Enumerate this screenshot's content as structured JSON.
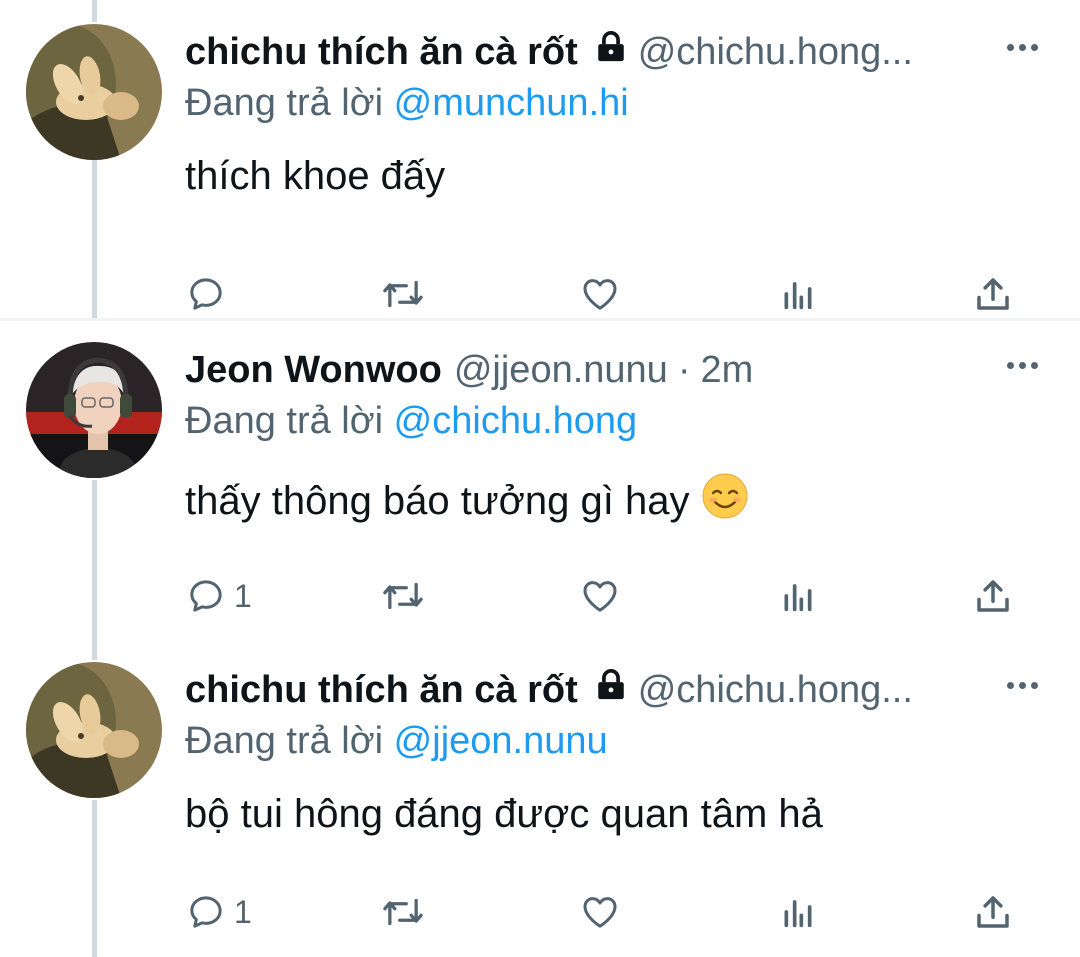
{
  "tweets": [
    {
      "name": "chichu thích ăn cà rốt",
      "handle": "@chichu.hong...",
      "locked": true,
      "time": "",
      "replying_prefix": "Đang trả lời",
      "replying_to": "@munchun.hi",
      "text": "thích khoe đấy",
      "reply_count": "",
      "avatar": "bunny-avatar"
    },
    {
      "name": "Jeon Wonwoo",
      "handle": "@jjeon.nunu",
      "locked": false,
      "separator": "·",
      "time": "2m",
      "replying_prefix": "Đang trả lời",
      "replying_to": "@chichu.hong",
      "text": "thấy thông báo tưởng gì hay",
      "emoji": "smiling-face-emoji",
      "reply_count": "1",
      "avatar": "person-with-headset-avatar"
    },
    {
      "name": "chichu thích ăn cà rốt",
      "handle": "@chichu.hong...",
      "locked": true,
      "time": "",
      "replying_prefix": "Đang trả lời",
      "replying_to": "@jjeon.nunu",
      "text": "bộ tui hông đáng được quan tâm hả",
      "reply_count": "1",
      "avatar": "bunny-avatar"
    }
  ],
  "icons": {
    "reply": "reply-icon",
    "retweet": "retweet-icon",
    "like": "heart-icon",
    "views": "views-icon",
    "share": "share-icon",
    "more": "more-icon",
    "lock": "lock-icon"
  },
  "colors": {
    "text": "#0f1419",
    "secondary": "#536471",
    "mention": "#1d9bf0",
    "thread_line": "#cfd9de"
  }
}
